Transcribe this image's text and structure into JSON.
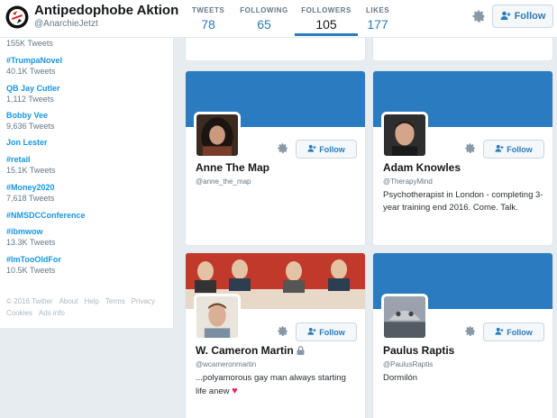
{
  "profile": {
    "name": "Antipedophobe Aktion",
    "handle": "@AnarchieJetzt"
  },
  "stats": [
    {
      "label": "TWEETS",
      "value": "78"
    },
    {
      "label": "FOLLOWING",
      "value": "65"
    },
    {
      "label": "FOLLOWERS",
      "value": "105"
    },
    {
      "label": "LIKES",
      "value": "177"
    }
  ],
  "top_follow_label": "Follow",
  "trends": [
    {
      "count": "155K Tweets"
    },
    {
      "tag": "#TrumpaNovel",
      "count": "40.1K Tweets"
    },
    {
      "tag": "QB Jay Cutler",
      "count": "1,112 Tweets"
    },
    {
      "tag": "Bobby Vee",
      "count": "9,636 Tweets"
    },
    {
      "tag": "Jon Lester"
    },
    {
      "tag": "#retail",
      "count": "15.1K Tweets"
    },
    {
      "tag": "#Money2020",
      "count": "7,618 Tweets"
    },
    {
      "tag": "#NMSDCConference"
    },
    {
      "tag": "#ibmwow",
      "count": "13.3K Tweets"
    },
    {
      "tag": "#ImTooOldFor",
      "count": "10.5K Tweets"
    }
  ],
  "footer": {
    "copyright": "© 2016 Twitter",
    "about": "About",
    "help": "Help",
    "terms": "Terms",
    "privacy": "Privacy",
    "cookies": "Cookies",
    "ads": "Ads info"
  },
  "cards": [
    {
      "name": "Anne The Map",
      "handle": "@anne_the_map",
      "follow": "Follow"
    },
    {
      "name": "Adam Knowles",
      "handle": "@TherapyMind",
      "bio": "Psychotherapist in London - completing 3-year training end 2016. Come. Talk.",
      "follow": "Follow"
    },
    {
      "name": "W. Cameron Martin",
      "handle": "@wcameronmartin",
      "bio": "...polyamorous gay man always starting life anew",
      "follow": "Follow"
    },
    {
      "name": "Paulus Raptis",
      "handle": "@PaulusRaptis",
      "bio": "Dormilón",
      "follow": "Follow"
    }
  ],
  "colors": {
    "accent": "#2b7bb9",
    "banner": "#2a7bbf",
    "trend_link": "#1b95e0",
    "heart": "#e0245e"
  }
}
